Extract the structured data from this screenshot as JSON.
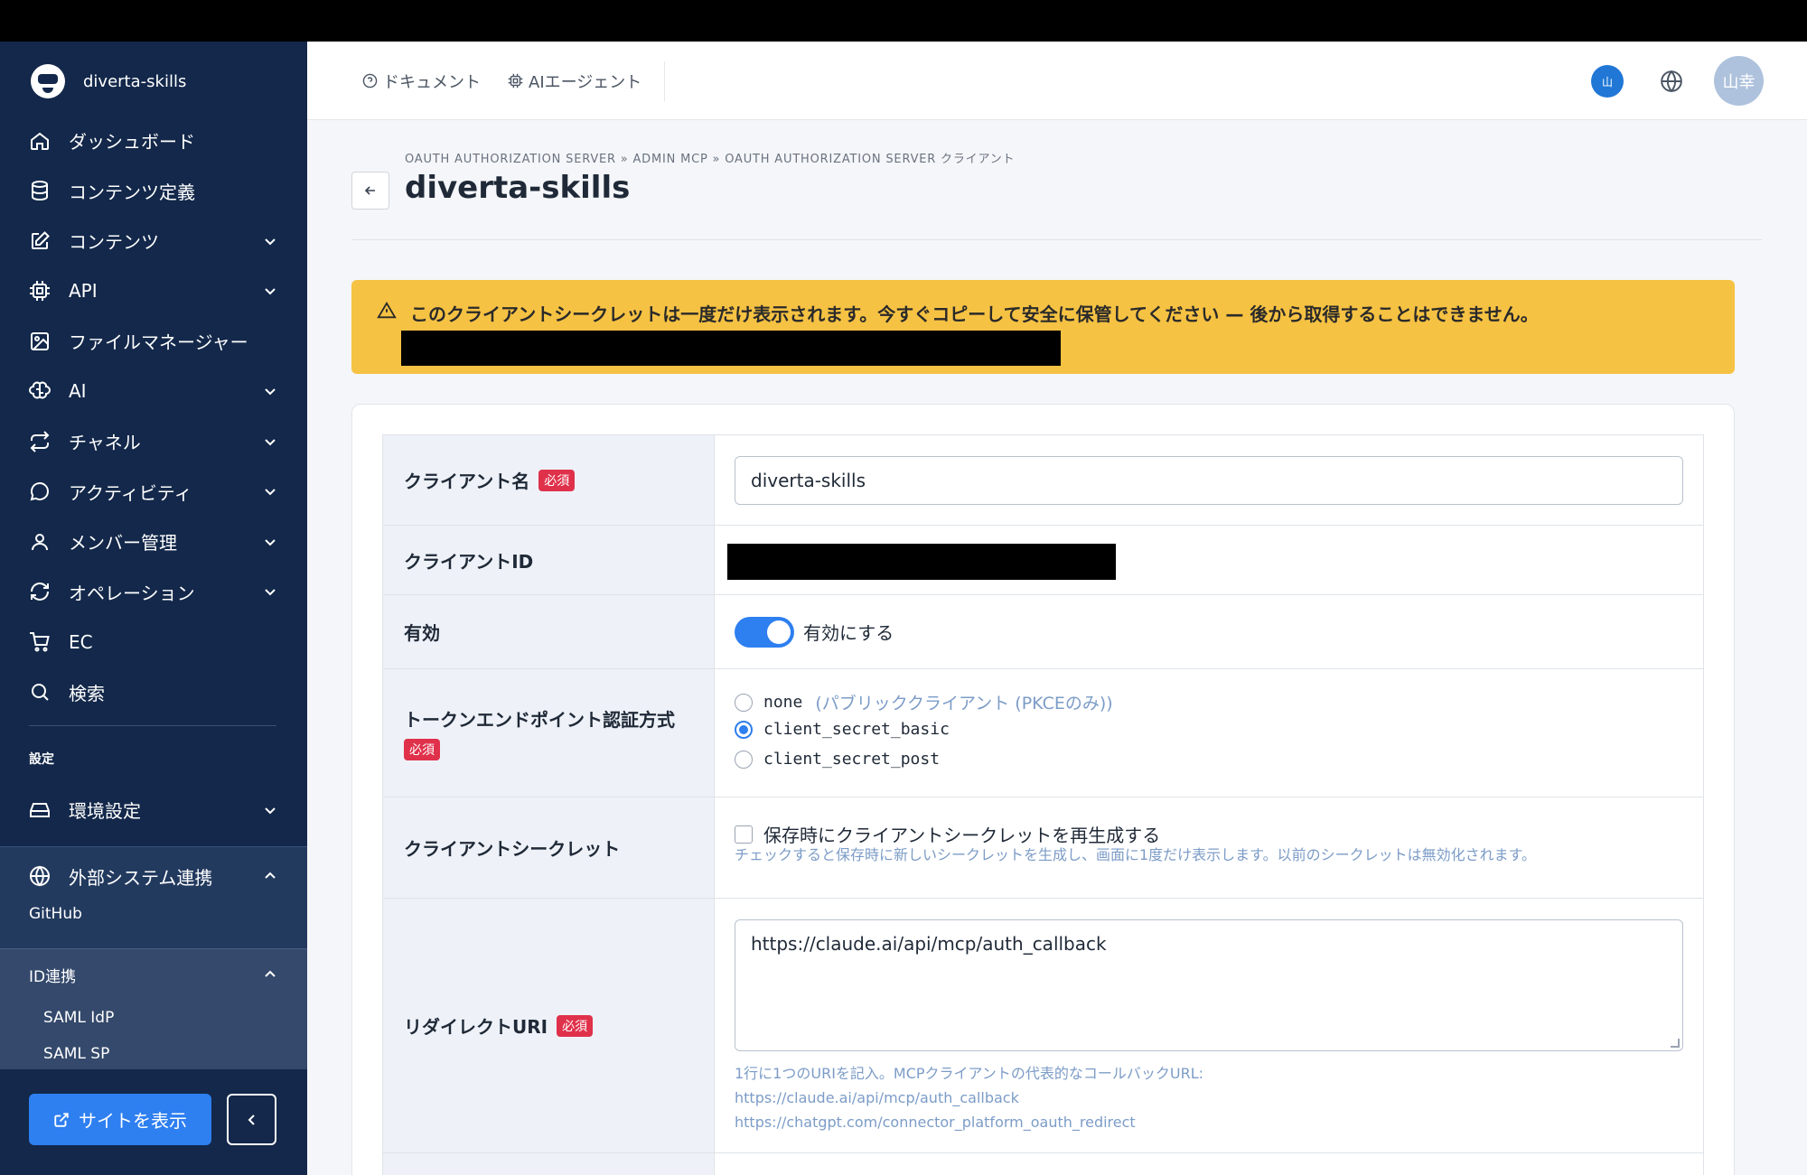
{
  "brand": {
    "name": "diverta-skills"
  },
  "sidebar": {
    "items": [
      {
        "label": "ダッシュボード",
        "icon": "home-icon",
        "expandable": false
      },
      {
        "label": "コンテンツ定義",
        "icon": "database-icon",
        "expandable": false
      },
      {
        "label": "コンテンツ",
        "icon": "edit-icon",
        "expandable": true
      },
      {
        "label": "API",
        "icon": "chip-icon",
        "expandable": true
      },
      {
        "label": "ファイルマネージャー",
        "icon": "image-icon",
        "expandable": false
      },
      {
        "label": "AI",
        "icon": "brain-icon",
        "expandable": true
      },
      {
        "label": "チャネル",
        "icon": "repeat-icon",
        "expandable": true
      },
      {
        "label": "アクティビティ",
        "icon": "chat-icon",
        "expandable": true
      },
      {
        "label": "メンバー管理",
        "icon": "user-icon",
        "expandable": true
      },
      {
        "label": "オペレーション",
        "icon": "refresh-icon",
        "expandable": true
      },
      {
        "label": "EC",
        "icon": "cart-icon",
        "expandable": false
      },
      {
        "label": "検索",
        "icon": "search-icon",
        "expandable": false
      }
    ],
    "settings_label": "設定",
    "env_settings_label": "環境設定",
    "external_label": "外部システム連携",
    "external_sub": "GitHub",
    "id_label": "ID連携",
    "id_subs": [
      "SAML IdP",
      "SAML SP"
    ],
    "site_button": "サイトを表示"
  },
  "header": {
    "docs_label": "ドキュメント",
    "agent_label": "AIエージェント",
    "badge": "山",
    "avatar": "山幸"
  },
  "page": {
    "breadcrumb": "OAUTH AUTHORIZATION SERVER » ADMIN MCP » OAUTH AUTHORIZATION SERVER クライアント",
    "title": "diverta-skills"
  },
  "alert": {
    "text": "このクライアントシークレットは一度だけ表示されます。今すぐコピーして安全に保管してください — 後から取得することはできません。"
  },
  "form": {
    "required_badge": "必須",
    "client_name": {
      "label": "クライアント名",
      "value": "diverta-skills"
    },
    "client_id": {
      "label": "クライアントID"
    },
    "enabled": {
      "label": "有効",
      "toggle_label": "有効にする",
      "on": true
    },
    "auth_method": {
      "label": "トークンエンドポイント認証方式",
      "options": [
        {
          "value": "none",
          "hint": "(パブリッククライアント (PKCEのみ))",
          "selected": false
        },
        {
          "value": "client_secret_basic",
          "hint": "",
          "selected": true
        },
        {
          "value": "client_secret_post",
          "hint": "",
          "selected": false
        }
      ]
    },
    "client_secret": {
      "label": "クライアントシークレット",
      "checkbox_label": "保存時にクライアントシークレットを再生成する",
      "help": "チェックすると保存時に新しいシークレットを生成し、画面に1度だけ表示します。以前のシークレットは無効化されます。"
    },
    "redirect_uri": {
      "label": "リダイレクトURI",
      "value": "https://claude.ai/api/mcp/auth_callback",
      "help_1": "1行に1つのURIを記入。MCPクライアントの代表的なコールバックURL:",
      "help_2": "https://claude.ai/api/mcp/auth_callback",
      "help_3": "https://chatgpt.com/connector_platform_oauth_redirect"
    }
  },
  "colors": {
    "sidebar": "#13284a",
    "accent": "#2e7ff0",
    "alert": "#f6c243",
    "required": "#e0314b"
  }
}
